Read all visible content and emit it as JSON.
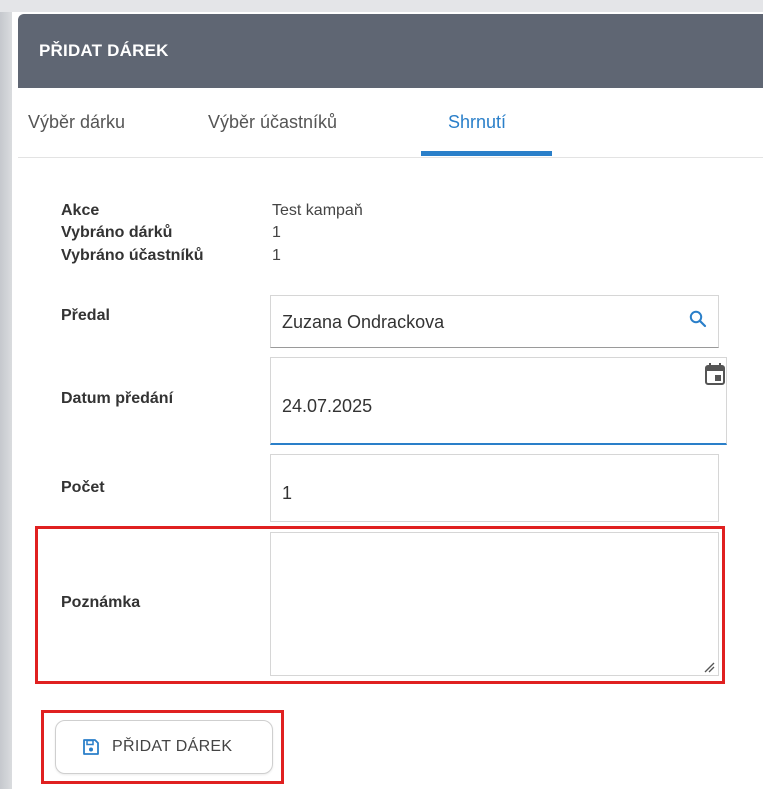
{
  "dialog": {
    "title": "PŘIDAT DÁREK"
  },
  "tabs": [
    {
      "label": "Výběr dárku"
    },
    {
      "label": "Výběr účastníků"
    },
    {
      "label": "Shrnutí",
      "active": true
    }
  ],
  "summary": {
    "action_label": "Akce",
    "action_value": "Test kampaň",
    "gifts_label": "Vybráno dárků",
    "gifts_value": "1",
    "participants_label": "Vybráno účastníků",
    "participants_value": "1"
  },
  "form": {
    "handed_by_label": "Předal",
    "handed_by_value": "Zuzana Ondrackova",
    "date_label": "Datum předání",
    "date_value": "24.07.2025",
    "count_label": "Počet",
    "count_value": "1",
    "note_label": "Poznámka",
    "note_value": ""
  },
  "actions": {
    "add_button_label": "PŘIDAT DÁREK"
  },
  "colors": {
    "header_bg": "#5f6673",
    "accent": "#2a7fc9",
    "highlight": "#e02020"
  },
  "icons": {
    "search": "search-icon",
    "calendar": "calendar-icon",
    "save": "save-icon",
    "resize": "resize-handle-icon"
  }
}
